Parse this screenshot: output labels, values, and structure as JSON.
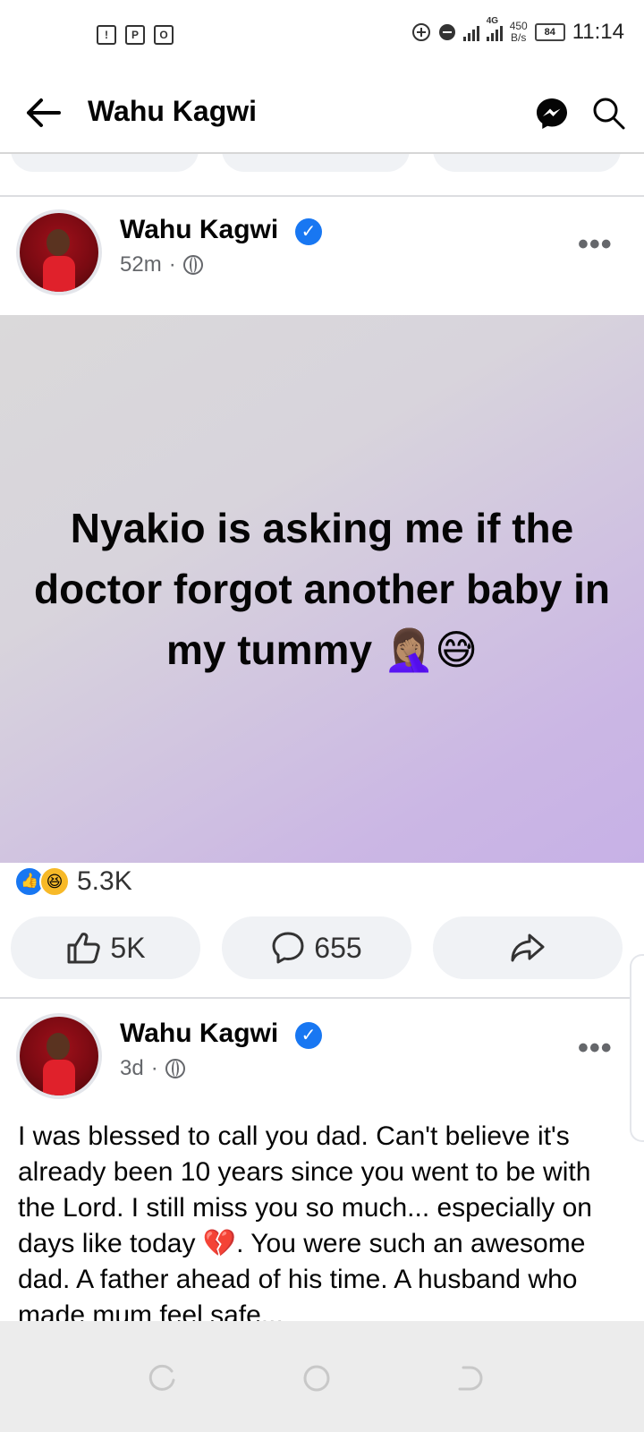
{
  "status_bar": {
    "network_type": "4G",
    "speed_value": "450",
    "speed_unit": "B/s",
    "battery": "84",
    "time": "11:14"
  },
  "header": {
    "title": "Wahu Kagwi"
  },
  "post1": {
    "author": "Wahu Kagwi",
    "time": "52m",
    "text": "Nyakio is asking me if the doctor forgot another baby in my tummy 🤦🏽‍♀️😅",
    "reaction_count": "5.3K",
    "like_count": "5K",
    "comment_count": "655"
  },
  "post2": {
    "author": "Wahu Kagwi",
    "time": "3d",
    "text": "I was blessed to call you dad. Can't believe it's already been 10 years since you went to be with the Lord. I still miss you so much... especially on days like today 💔. You were such an awesome dad. A father ahead of his time. A husband who made mum feel safe..."
  },
  "colors": {
    "facebook_blue": "#1877f2",
    "secondary_text": "#65676b",
    "button_bg": "#f0f2f5"
  }
}
